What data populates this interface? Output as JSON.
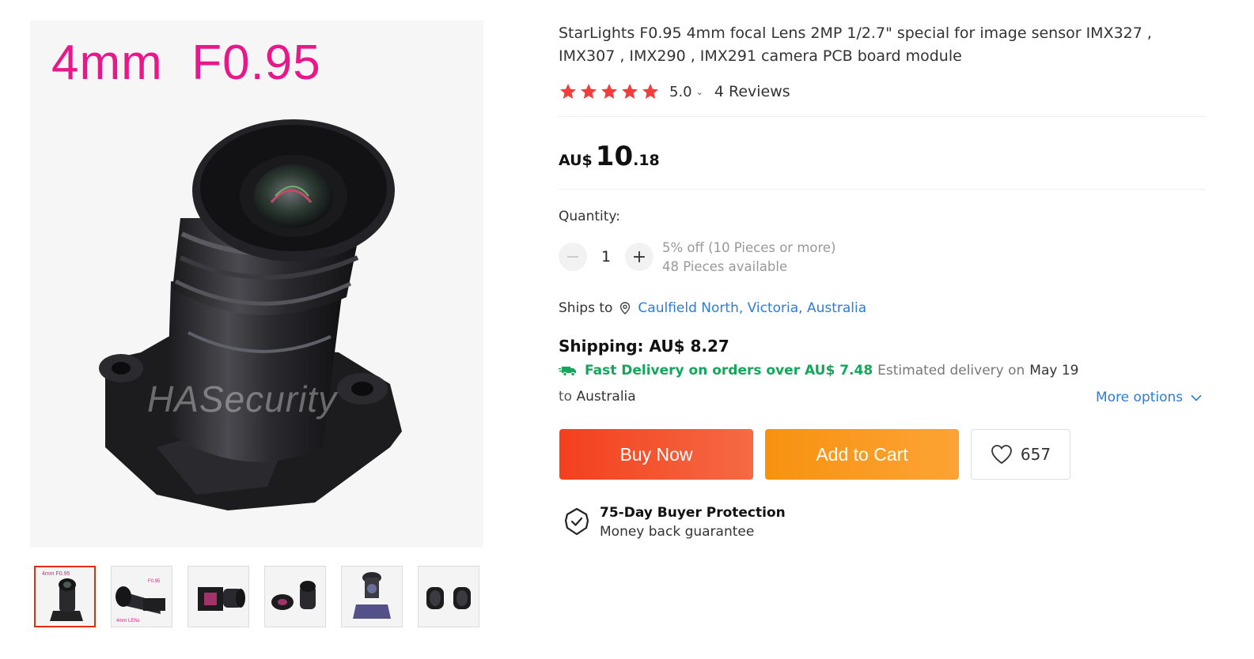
{
  "gallery": {
    "main_caption": "4mm  F0.95",
    "watermark": "HASecurity",
    "thumbnails": [
      {
        "name": "thumb-1",
        "active": true
      },
      {
        "name": "thumb-2",
        "active": false
      },
      {
        "name": "thumb-3",
        "active": false
      },
      {
        "name": "thumb-4",
        "active": false
      },
      {
        "name": "thumb-5",
        "active": false
      },
      {
        "name": "thumb-6",
        "active": false
      }
    ],
    "thumb_captions": {
      "t1": "4mm  F0.95",
      "t2_top": "F0.95",
      "t2_bottom": "4mm LENs"
    }
  },
  "product": {
    "title": "StarLights F0.95 4mm focal Lens 2MP 1/2.7\" special for image sensor IMX327 , IMX307 , IMX290 , IMX291 camera PCB board module",
    "rating": {
      "stars": 5,
      "value": "5.0",
      "reviews_label": "4 Reviews"
    },
    "price": {
      "currency": "AU$",
      "integer": "10",
      "decimal": ".18"
    }
  },
  "quantity": {
    "label": "Quantity:",
    "value": "1",
    "decrement": "−",
    "increment": "+",
    "discount_note": "5% off (10 Pieces or more)",
    "available": "48 Pieces available"
  },
  "shipping": {
    "ships_to_label": "Ships to",
    "location": "Caulfield North, Victoria, Australia",
    "cost": "Shipping: AU$ 8.27",
    "fast_delivery": "Fast Delivery on orders over AU$ 7.48",
    "estimated_label": "Estimated delivery on",
    "estimated_date": "May 19",
    "to_label": "to",
    "to_country": "Australia",
    "more_options": "More options"
  },
  "actions": {
    "buy_now": "Buy Now",
    "add_to_cart": "Add to Cart",
    "wishlist_count": "657"
  },
  "protection": {
    "title": "75-Day Buyer Protection",
    "subtitle": "Money back guarantee"
  },
  "colors": {
    "accent_red": "#e62e04",
    "star": "#f33d3d",
    "link": "#2e7cd6",
    "green": "#12a75a",
    "buy_now": "#f3401e",
    "add_to_cart": "#f79210"
  },
  "icons": {
    "star": "star-icon",
    "location": "location-pin-icon",
    "truck": "truck-icon",
    "chevron": "chevron-down-icon",
    "heart": "heart-icon",
    "shield": "shield-check-icon"
  }
}
